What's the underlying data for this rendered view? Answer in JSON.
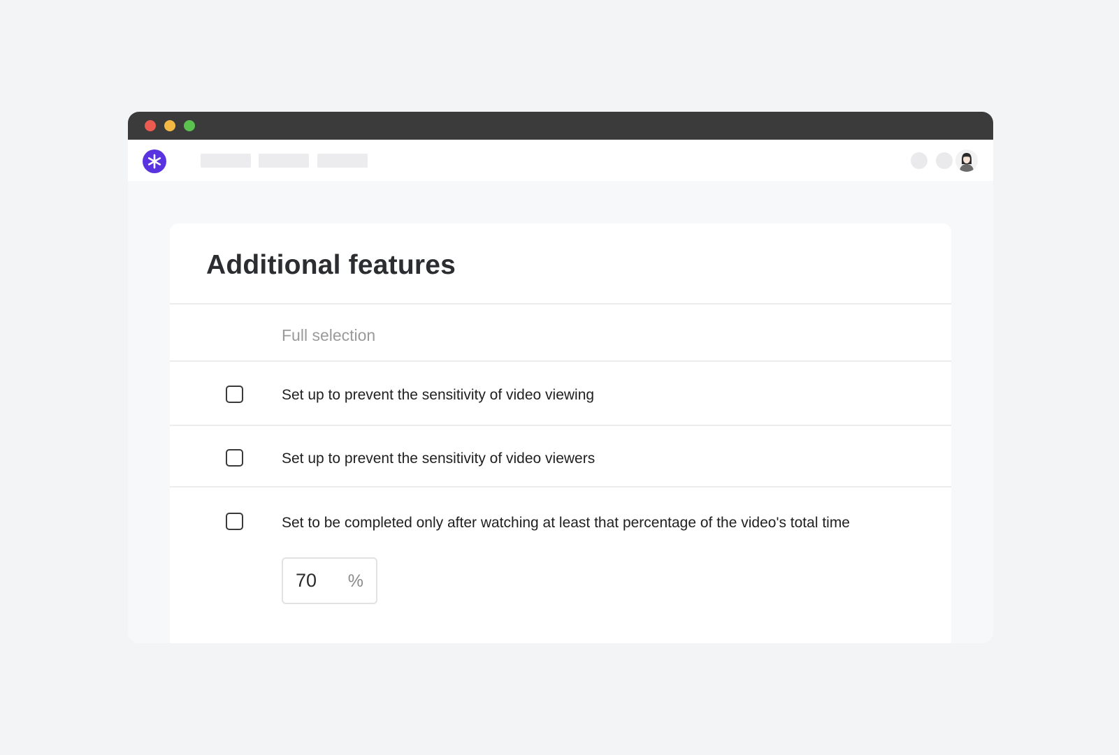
{
  "card": {
    "title": "Additional features",
    "full_selection_label": "Full selection",
    "options": [
      {
        "label": "Set up to prevent the sensitivity of video viewing",
        "checked": false
      },
      {
        "label": "Set up to prevent the sensitivity of video viewers",
        "checked": false
      },
      {
        "label": "Set to be completed only after watching at least that percentage of the video's total time",
        "checked": false
      }
    ],
    "percentage": {
      "value": "70",
      "unit": "%"
    }
  },
  "colors": {
    "logo": "#5a33e0",
    "titlebar": "#3b3b3b",
    "dot_red": "#ec5b50",
    "dot_yellow": "#f4b942",
    "dot_green": "#5bc24f"
  },
  "icons": {
    "logo": "asterisk-logo-icon",
    "avatar": "user-avatar"
  }
}
